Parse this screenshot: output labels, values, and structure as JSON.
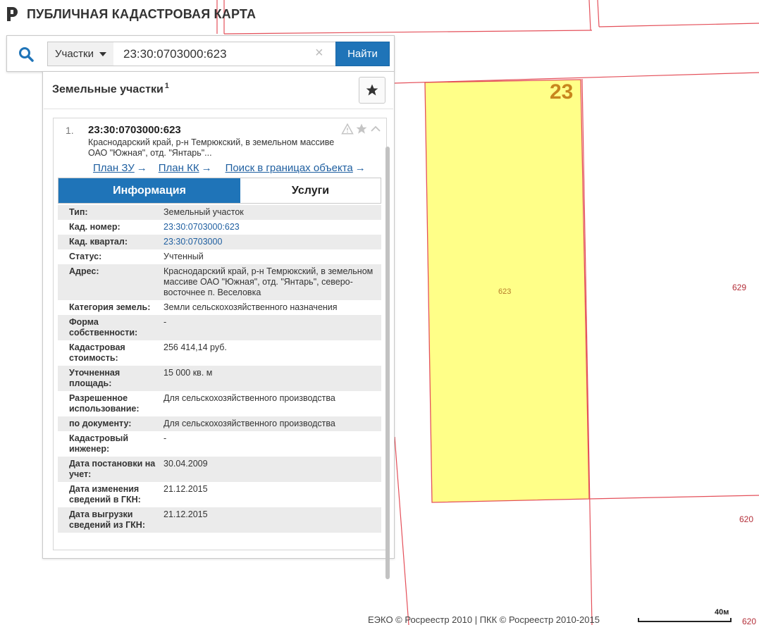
{
  "header": {
    "title": "ПУБЛИЧНАЯ КАДАСТРОВАЯ КАРТА"
  },
  "search": {
    "type_label": "Участки",
    "query": "23:30:0703000:623",
    "clear_glyph": "×",
    "button_label": "Найти"
  },
  "panel": {
    "title": "Земельные участки",
    "count": "1"
  },
  "result": {
    "index": "1.",
    "cad_number": "23:30:0703000:623",
    "address_short": "Краснодарский край, р-н Темрюкский, в земельном массиве ОАО \"Южная\", отд. \"Янтарь\"...",
    "links": [
      {
        "label": "План ЗУ",
        "arrow": "→"
      },
      {
        "label": "План КК",
        "arrow": "→"
      },
      {
        "label": "Поиск в границах объекта",
        "arrow": "→"
      }
    ],
    "tabs": {
      "info": "Информация",
      "services": "Услуги"
    },
    "rows": [
      {
        "key": "Тип:",
        "value": "Земельный участок"
      },
      {
        "key": "Кад. номер:",
        "value": "23:30:0703000:623",
        "link": true
      },
      {
        "key": "Кад. квартал:",
        "value": "23:30:0703000",
        "link": true
      },
      {
        "key": "Статус:",
        "value": "Учтенный"
      },
      {
        "key": "Адрес:",
        "value": "Краснодарский край, р-н Темрюкский, в земельном массиве ОАО \"Южная\", отд. \"Янтарь\", северо-восточнее п. Веселовка"
      },
      {
        "key": "Категория земель:",
        "value": "Земли сельскохозяйственного назначения"
      },
      {
        "key": "Форма собственности:",
        "value": "-"
      },
      {
        "key": "Кадастровая стоимость:",
        "value": "256 414,14 руб."
      },
      {
        "key": "Уточненная площадь:",
        "value": "15 000 кв. м"
      },
      {
        "key": "Разрешенное использование:",
        "value": "Для сельскохозяйственного производства"
      },
      {
        "key": "по документу:",
        "value": "Для сельскохозяйственного производства"
      },
      {
        "key": "Кадастровый инженер:",
        "value": "-"
      },
      {
        "key": "Дата постановки на учет:",
        "value": "30.04.2009"
      },
      {
        "key": "Дата изменения сведений в ГКН:",
        "value": "21.12.2015"
      },
      {
        "key": "Дата выгрузки сведений из ГКН:",
        "value": "21.12.2015"
      }
    ]
  },
  "map": {
    "region_label": "23",
    "parcel_labels": [
      "623",
      "629",
      "620",
      "620"
    ],
    "parcel_fill": "#ffff88",
    "border_color": "#e4505a",
    "accent": "#1f74b8"
  },
  "footer": {
    "attribution": "ЕЭКО © Росреестр 2010 | ПКК © Росреестр 2010-2015",
    "scale": "40м"
  }
}
